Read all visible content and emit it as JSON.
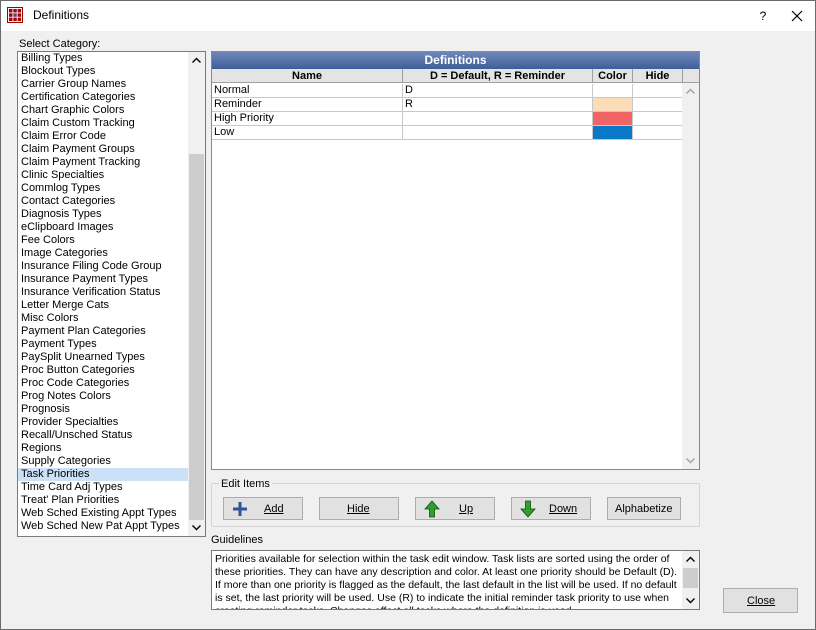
{
  "window": {
    "title": "Definitions",
    "help_label": "?"
  },
  "category": {
    "label": "Select Category:",
    "items": [
      "Billing Types",
      "Blockout Types",
      "Carrier Group Names",
      "Certification Categories",
      "Chart Graphic Colors",
      "Claim Custom Tracking",
      "Claim Error Code",
      "Claim Payment Groups",
      "Claim Payment Tracking",
      "Clinic Specialties",
      "Commlog Types",
      "Contact Categories",
      "Diagnosis Types",
      "eClipboard Images",
      "Fee Colors",
      "Image Categories",
      "Insurance Filing Code Group",
      "Insurance Payment Types",
      "Insurance Verification Status",
      "Letter Merge Cats",
      "Misc Colors",
      "Payment Plan Categories",
      "Payment Types",
      "PaySplit Unearned Types",
      "Proc Button Categories",
      "Proc Code Categories",
      "Prog Notes Colors",
      "Prognosis",
      "Provider Specialties",
      "Recall/Unsched Status",
      "Regions",
      "Supply Categories",
      "Task Priorities",
      "Time Card Adj Types",
      "Treat' Plan Priorities",
      "Web Sched Existing Appt Types",
      "Web Sched New Pat Appt Types"
    ],
    "selected": "Task Priorities"
  },
  "grid": {
    "title": "Definitions",
    "columns": {
      "name": "Name",
      "code": "D = Default, R = Reminder",
      "color": "Color",
      "hide": "Hide"
    },
    "rows": [
      {
        "name": "Normal",
        "code": "D",
        "color": "#ffffff"
      },
      {
        "name": "Reminder",
        "code": "R",
        "color": "#fcdcb6"
      },
      {
        "name": "High Priority",
        "code": "",
        "color": "#f06464"
      },
      {
        "name": "Low",
        "code": "",
        "color": "#0a78c8"
      }
    ]
  },
  "edit_items": {
    "label": "Edit Items",
    "add": "Add",
    "hide": "Hide",
    "up": "Up",
    "down": "Down",
    "alphabetize": "Alphabetize"
  },
  "guidelines": {
    "label": "Guidelines",
    "text": "Priorities available for selection within the task edit window.  Task lists are sorted using the order of these priorities.  They can have any description and color.  At least one priority should be Default (D).  If more than one priority is flagged as the default, the last default in the list will be used.  If no default is set, the last priority will be used.  Use (R) to indicate the initial reminder task priority to use when creating reminder tasks.  Changes affect all tasks where the definition is used."
  },
  "close_label": "Close"
}
